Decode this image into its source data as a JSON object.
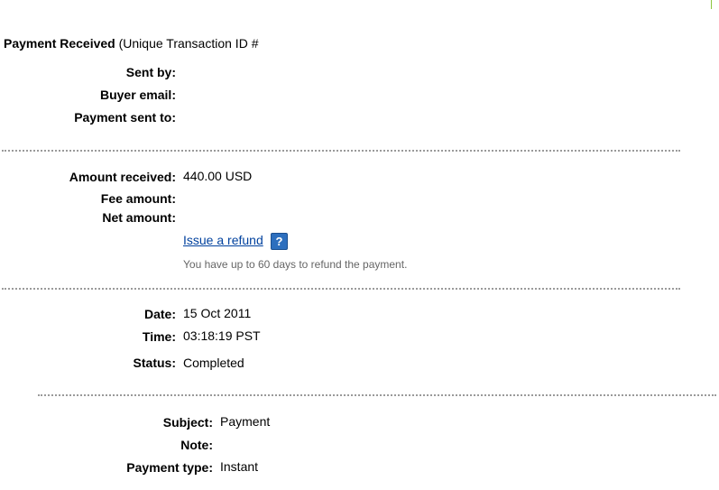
{
  "header": {
    "title_bold": "Payment Received",
    "title_rest": " (Unique Transaction ID #"
  },
  "parties": {
    "sent_by_label": "Sent by:",
    "buyer_email_label": "Buyer email:",
    "payment_sent_to_label": "Payment sent to:"
  },
  "amounts": {
    "amount_received_label": "Amount received:",
    "amount_received_value": "440.00 USD",
    "fee_amount_label": "Fee amount:",
    "net_amount_label": "Net amount:",
    "refund_link": "Issue a refund",
    "refund_help_glyph": "?",
    "refund_hint": "You have up to 60 days to refund the payment."
  },
  "details": {
    "date_label": "Date:",
    "date_value": "15 Oct 2011",
    "time_label": "Time:",
    "time_value": "03:18:19 PST",
    "status_label": "Status:",
    "status_value": "Completed"
  },
  "extra": {
    "subject_label": "Subject:",
    "subject_value": "Payment",
    "note_label": "Note:",
    "payment_type_label": "Payment type:",
    "payment_type_value": "Instant"
  },
  "colors": {
    "link": "#00419e",
    "help_icon_bg": "#2d6fbe",
    "divider": "#9a9a9a",
    "hint_text": "#666666"
  },
  "icons": {
    "help": "question-mark-icon"
  }
}
